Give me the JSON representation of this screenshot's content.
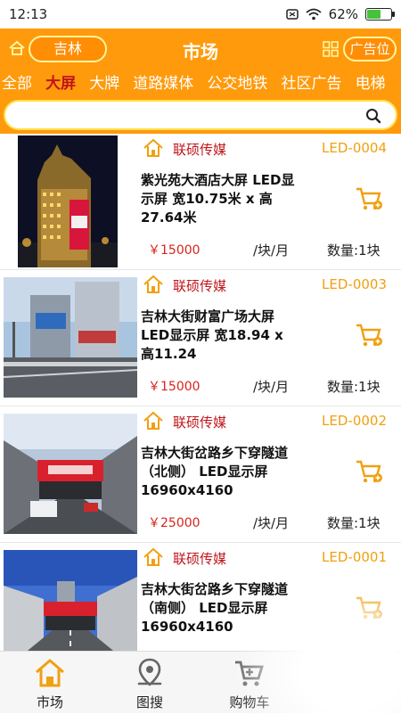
{
  "status": {
    "time": "12:13",
    "battery": "62%",
    "battery_level": 0.62
  },
  "header": {
    "city": "吉林",
    "title": "市场",
    "ad_button": "广告位"
  },
  "tabs": [
    {
      "label": "全部"
    },
    {
      "label": "大屏"
    },
    {
      "label": "大牌"
    },
    {
      "label": "道路媒体"
    },
    {
      "label": "公交地铁"
    },
    {
      "label": "社区广告"
    },
    {
      "label": "电梯"
    }
  ],
  "search": {
    "placeholder": ""
  },
  "items": [
    {
      "vendor": "联硕传媒",
      "code": "LED-0004",
      "title": "紫光苑大酒店大屏 LED显示屏 宽10.75米 x 高27.64米",
      "price": "￥15000",
      "unit": "/块/月",
      "qty": "数量:1块"
    },
    {
      "vendor": "联硕传媒",
      "code": "LED-0003",
      "title": "吉林大街财富广场大屏 LED显示屏 宽18.94 x 高11.24",
      "price": "￥15000",
      "unit": "/块/月",
      "qty": "数量:1块"
    },
    {
      "vendor": "联硕传媒",
      "code": "LED-0002",
      "title": "吉林大街岔路乡下穿隧道（北侧） LED显示屏 16960x4160",
      "price": "￥25000",
      "unit": "/块/月",
      "qty": "数量:1块"
    },
    {
      "vendor": "联硕传媒",
      "code": "LED-0001",
      "title": "吉林大街岔路乡下穿隧道（南侧） LED显示屏 16960x4160",
      "price": "",
      "unit": "",
      "qty": ""
    }
  ],
  "nav": [
    {
      "label": "市场",
      "icon": "home-icon"
    },
    {
      "label": "图搜",
      "icon": "map-pin-icon"
    },
    {
      "label": "购物车",
      "icon": "cart-icon"
    },
    {
      "label": "",
      "icon": ""
    }
  ],
  "colors": {
    "accent": "#ff9a0c",
    "active_tab": "#c0151b",
    "price": "#d8231d",
    "code": "#f0a010"
  }
}
